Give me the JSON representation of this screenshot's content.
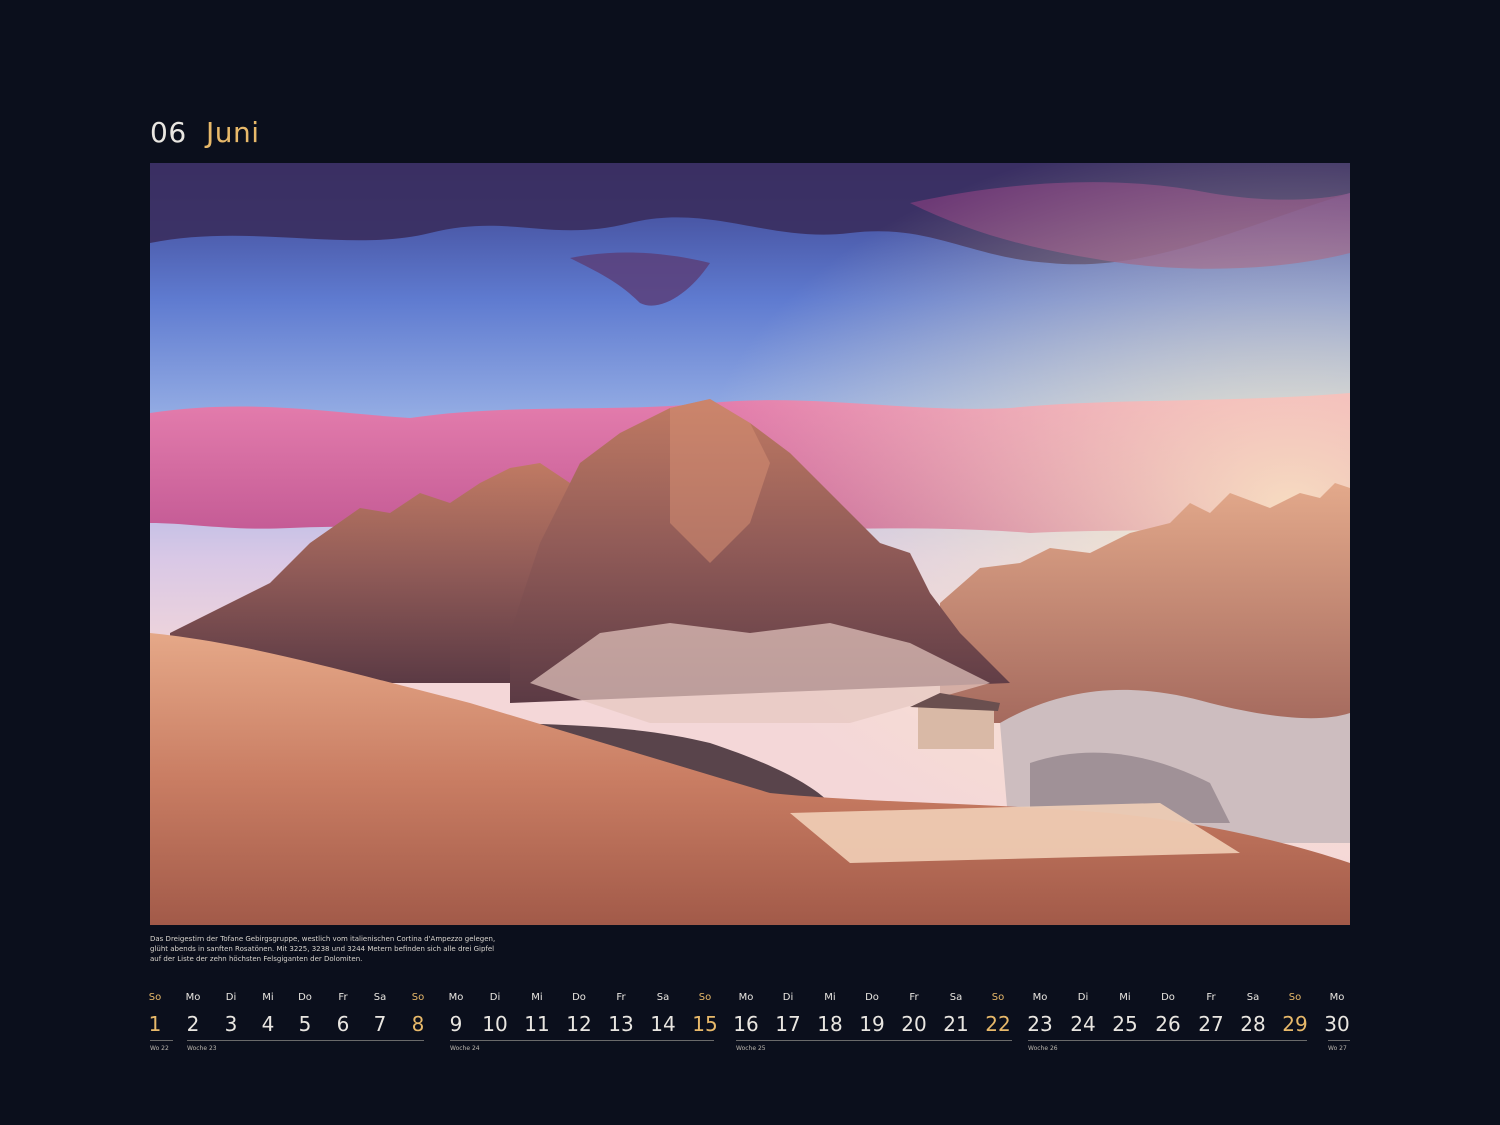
{
  "header": {
    "number": "06",
    "month": "Juni"
  },
  "caption": {
    "lines": [
      "Das Dreigestirn der Tofane Gebirgsgruppe, westlich vom italienischen Cortina d'Ampezzo gelegen,",
      "glüht abends in sanften Rosatönen. Mit 3225, 3238 und 3244 Metern befinden sich alle drei Gipfel",
      "auf der Liste der zehn höchsten Felsgiganten der Dolomiten."
    ]
  },
  "calendar": {
    "days": [
      {
        "dow": "So",
        "date": "1",
        "sunday": true
      },
      {
        "dow": "Mo",
        "date": "2"
      },
      {
        "dow": "Di",
        "date": "3"
      },
      {
        "dow": "Mi",
        "date": "4"
      },
      {
        "dow": "Do",
        "date": "5"
      },
      {
        "dow": "Fr",
        "date": "6"
      },
      {
        "dow": "Sa",
        "date": "7"
      },
      {
        "dow": "So",
        "date": "8",
        "sunday": true
      },
      {
        "dow": "Mo",
        "date": "9"
      },
      {
        "dow": "Di",
        "date": "10"
      },
      {
        "dow": "Mi",
        "date": "11"
      },
      {
        "dow": "Do",
        "date": "12"
      },
      {
        "dow": "Fr",
        "date": "13"
      },
      {
        "dow": "Sa",
        "date": "14"
      },
      {
        "dow": "So",
        "date": "15",
        "sunday": true
      },
      {
        "dow": "Mo",
        "date": "16"
      },
      {
        "dow": "Di",
        "date": "17"
      },
      {
        "dow": "Mi",
        "date": "18"
      },
      {
        "dow": "Do",
        "date": "19"
      },
      {
        "dow": "Fr",
        "date": "20"
      },
      {
        "dow": "Sa",
        "date": "21"
      },
      {
        "dow": "So",
        "date": "22",
        "sunday": true
      },
      {
        "dow": "Mo",
        "date": "23"
      },
      {
        "dow": "Di",
        "date": "24"
      },
      {
        "dow": "Mi",
        "date": "25"
      },
      {
        "dow": "Do",
        "date": "26"
      },
      {
        "dow": "Fr",
        "date": "27"
      },
      {
        "dow": "Sa",
        "date": "28"
      },
      {
        "dow": "So",
        "date": "29",
        "sunday": true
      },
      {
        "dow": "Mo",
        "date": "30"
      }
    ],
    "weeks": [
      "Wo 22",
      "Woche 23",
      "Woche 24",
      "Woche 25",
      "Woche 26",
      "Wo 27"
    ]
  },
  "colors": {
    "background": "#0b0f1c",
    "accent": "#e8b96a",
    "text": "#e9e6e1"
  }
}
